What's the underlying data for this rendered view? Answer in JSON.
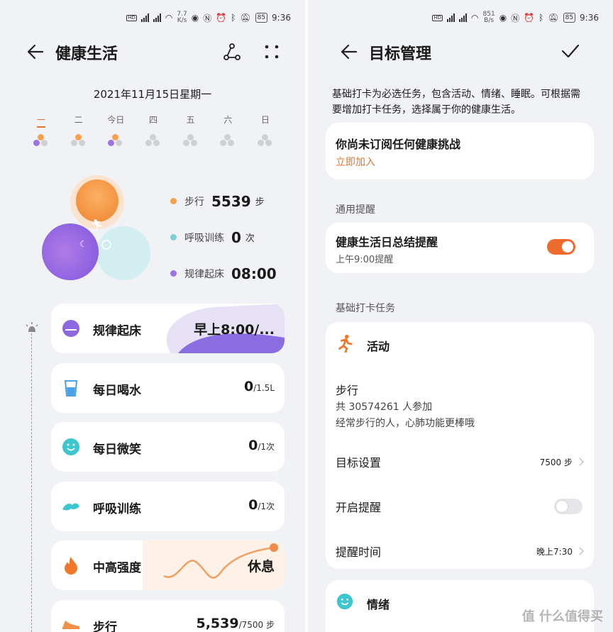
{
  "left": {
    "status": {
      "net_speed": "7.7",
      "net_unit": "K/s",
      "battery": "85",
      "time": "9:36"
    },
    "title": "健康生活",
    "date": "2021年11月15日星期一",
    "week": [
      {
        "label": "一",
        "active": true
      },
      {
        "label": "二",
        "active": false
      },
      {
        "label": "今日",
        "active": false
      },
      {
        "label": "四",
        "active": false
      },
      {
        "label": "五",
        "active": false
      },
      {
        "label": "六",
        "active": false
      },
      {
        "label": "日",
        "active": false
      }
    ],
    "legend": [
      {
        "label": "步行",
        "value": "5539",
        "unit": "步",
        "color": "#f6a14e"
      },
      {
        "label": "呼吸训练",
        "value": "0",
        "unit": "次",
        "color": "#7dcfd8"
      },
      {
        "label": "规律起床",
        "value": "08:00",
        "unit": "",
        "color": "#9b72e2"
      }
    ],
    "cards": [
      {
        "name": "规律起床",
        "value": "早上8:00/...",
        "sub": "",
        "icon": "sunrise-icon"
      },
      {
        "name": "每日喝水",
        "value": "0",
        "sub": "/1.5L",
        "icon": "water-cup-icon"
      },
      {
        "name": "每日微笑",
        "value": "0",
        "sub": "/1次",
        "icon": "smile-icon"
      },
      {
        "name": "呼吸训练",
        "value": "0",
        "sub": "/1次",
        "icon": "breath-icon"
      },
      {
        "name": "中高强度",
        "value": "休息",
        "sub": "",
        "icon": "flame-icon"
      },
      {
        "name": "步行",
        "value": "5,539",
        "sub": "/7500 步",
        "icon": "shoe-icon"
      }
    ]
  },
  "right": {
    "status": {
      "net_speed": "851",
      "net_unit": "B/s",
      "battery": "85",
      "time": "9:36"
    },
    "title": "目标管理",
    "intro": "基础打卡为必选任务，包含活动、情绪、睡眠。可根据需要增加打卡任务，选择属于你的健康生活。",
    "challenge": {
      "text": "你尚未订阅任何健康挑战",
      "link": "立即加入"
    },
    "general_label": "通用提醒",
    "summary_reminder": {
      "title": "健康生活日总结提醒",
      "sub": "上午9:00提醒",
      "enabled": true
    },
    "basic_label": "基础打卡任务",
    "activity": {
      "title": "活动",
      "walk_title": "步行",
      "walk_participants": "共 30574261 人参加",
      "walk_desc": "经常步行的人，心肺功能更棒哦",
      "goal_label": "目标设置",
      "goal_value": "7500 步",
      "remind_label": "开启提醒",
      "remind_enabled": false,
      "remind_time_label": "提醒时间",
      "remind_time_value": "晚上7:30"
    },
    "emotion_title": "情绪",
    "watermark": "值 什么值得买"
  },
  "colors": {
    "accent": "#ec6b2d",
    "orange": "#f6a14e",
    "teal": "#7dcfd8",
    "purple": "#9b72e2"
  }
}
